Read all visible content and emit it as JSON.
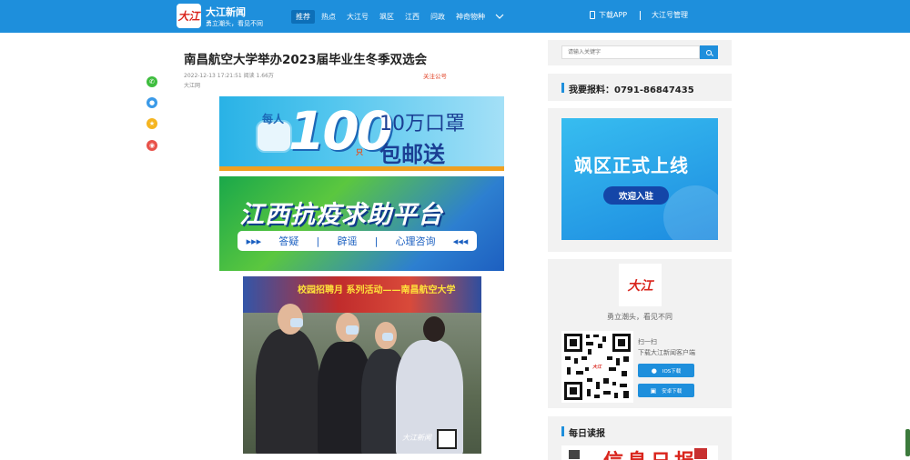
{
  "colors": {
    "primary": "#1e8fdc",
    "nav_active": "#0d6fb8",
    "brand_red": "#d9251d",
    "follow": "#e2462a"
  },
  "header": {
    "logo_text": "大江",
    "brand_name": "大江新闻",
    "slogan": "勇立潮头，看见不同",
    "nav": [
      "推荐",
      "热点",
      "大江号",
      "飒区",
      "江西",
      "问政",
      "神奇物种"
    ],
    "nav_active_index": 0,
    "download_app": "下载APP",
    "admin": "大江号管理"
  },
  "share_icons": [
    {
      "icon": "wechat-icon",
      "color": "#3ebd3e"
    },
    {
      "icon": "qq-icon",
      "color": "#3b9ae8"
    },
    {
      "icon": "qzone-icon",
      "color": "#f5b521"
    },
    {
      "icon": "weibo-icon",
      "color": "#e8524a"
    }
  ],
  "article": {
    "title": "南昌航空大学举办2023届毕业生冬季双选会",
    "meta": "2022-12-13 17:21:51 阅读 1.66万",
    "follow": "关注公号",
    "source": "大江网"
  },
  "banner1": {
    "mei": "每人",
    "num": "100",
    "zhi": "只",
    "line1": "10万口罩",
    "line2": "包邮送"
  },
  "banner2": {
    "title": "江西抗疫求助平台",
    "items": [
      "答疑",
      "辟谣",
      "心理咨询"
    ],
    "arrows_left": "▸▸▸",
    "arrows_right": "◂◂◂"
  },
  "photo": {
    "banner_text": "校园招聘月  系列活动——南昌航空大学",
    "logo": "大江新闻"
  },
  "sidebar": {
    "search_placeholder": "请输入关键字",
    "hotline": "我要报料：0791-86847435",
    "ad_title": "飒区正式上线",
    "ad_button": "欢迎入驻",
    "app_logo": "大江",
    "app_slogan": "勇立潮头，看见不同",
    "qr_center": "大江",
    "scan": "扫一扫",
    "scan_sub": "下载大江新闻客户端",
    "ios": "IOS下载",
    "android": "安卓下载",
    "daily_read": "每日读报",
    "paper_name": "信息日报"
  }
}
